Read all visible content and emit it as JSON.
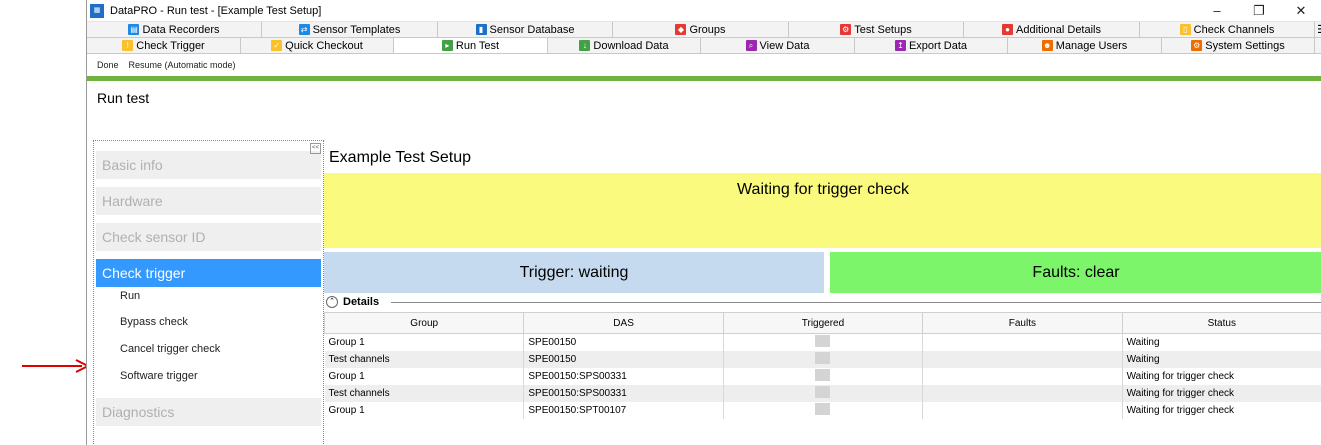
{
  "window": {
    "title": "DataPRO - Run test - [Example Test Setup]",
    "min": "–",
    "restore": "❐",
    "close": "✕"
  },
  "tabs_row1": [
    {
      "label": "Data Recorders",
      "color": "#1e88e5"
    },
    {
      "label": "Sensor Templates",
      "color": "#1e88e5"
    },
    {
      "label": "Sensor Database",
      "color": "#1e6fc7"
    },
    {
      "label": "Groups",
      "color": "#e53935"
    },
    {
      "label": "Test Setups",
      "color": "#e53935"
    },
    {
      "label": "Additional Details",
      "color": "#e53935"
    },
    {
      "label": "Check Channels",
      "color": "#fbc02d"
    }
  ],
  "tabs_row2": [
    {
      "label": "Check Trigger",
      "color": "#fbc02d"
    },
    {
      "label": "Quick Checkout",
      "color": "#fbc02d"
    },
    {
      "label": "Run Test",
      "color": "#43a047"
    },
    {
      "label": "Download Data",
      "color": "#43a047"
    },
    {
      "label": "View Data",
      "color": "#9c27b0"
    },
    {
      "label": "Export Data",
      "color": "#9c27b0"
    },
    {
      "label": "Manage Users",
      "color": "#ef6c00"
    },
    {
      "label": "System Settings",
      "color": "#ef6c00"
    }
  ],
  "overflow_icon": "☰",
  "actions": {
    "done": "Done",
    "resume": "Resume (Automatic mode)"
  },
  "page_title": "Run test",
  "sidebar": {
    "collapse": "<<",
    "sections": [
      "Basic info",
      "Hardware",
      "Check sensor ID"
    ],
    "active": "Check trigger",
    "subitems": [
      "Run",
      "Bypass check",
      "Cancel trigger check",
      "Software trigger"
    ],
    "after": "Diagnostics"
  },
  "main": {
    "test_name": "Example Test Setup",
    "waiting": "Waiting for trigger check",
    "trigger": "Trigger: waiting",
    "faults": "Faults: clear",
    "details": "Details"
  },
  "table": {
    "columns": [
      "Group",
      "DAS",
      "Triggered",
      "Faults",
      "Status"
    ],
    "rows": [
      [
        "Group 1",
        "SPE00150",
        "",
        "",
        "Waiting"
      ],
      [
        "Test channels",
        "SPE00150",
        "",
        "",
        "Waiting"
      ],
      [
        "Group 1",
        "SPE00150:SPS00331",
        "",
        "",
        "Waiting for trigger check"
      ],
      [
        "Test channels",
        "SPE00150:SPS00331",
        "",
        "",
        "Waiting for trigger check"
      ],
      [
        "Group 1",
        "SPE00150:SPT00107",
        "",
        "",
        "Waiting for trigger check"
      ]
    ]
  },
  "colors": {
    "accent_green": "#6fb23d",
    "yellow_banner": "#fafa7e",
    "trigger_blue": "#c5d9ef",
    "faults_green": "#7cf56a",
    "arrow_red": "#e00000",
    "selection_blue": "#3399ff"
  }
}
